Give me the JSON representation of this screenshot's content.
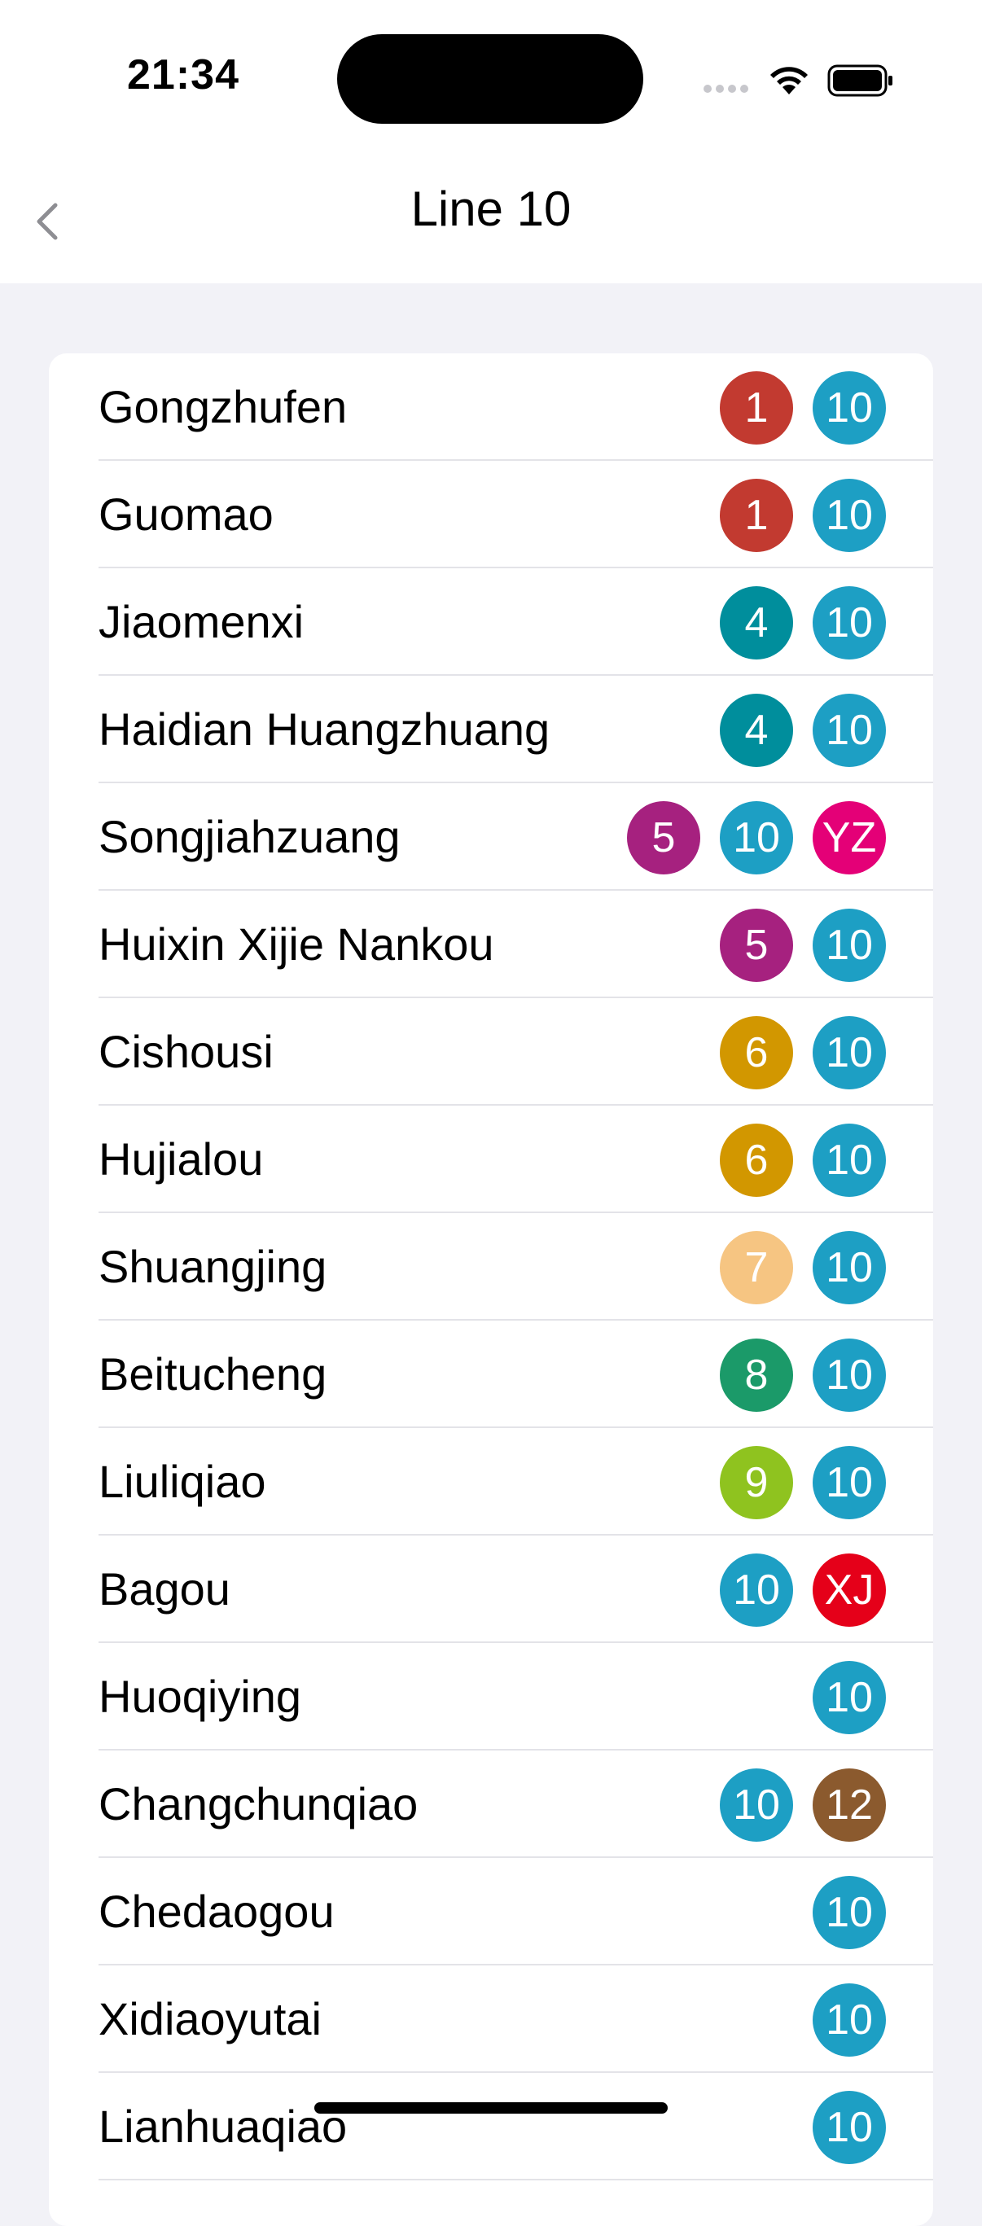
{
  "status": {
    "time": "21:34"
  },
  "nav": {
    "title": "Line 10",
    "back_icon": "chevron-left-icon"
  },
  "line_colors": {
    "1": "#c23a30",
    "4": "#008e9c",
    "5": "#a6217f",
    "6": "#d29700",
    "7": "#f6c582",
    "8": "#1b9a69",
    "9": "#8fc31f",
    "10": "#1d9fc4",
    "12": "#8b5a2e",
    "YZ": "#e40077",
    "XJ": "#e50019"
  },
  "stations": [
    {
      "name": "Gongzhufen",
      "lines": [
        "1",
        "10"
      ]
    },
    {
      "name": "Guomao",
      "lines": [
        "1",
        "10"
      ]
    },
    {
      "name": "Jiaomenxi",
      "lines": [
        "4",
        "10"
      ]
    },
    {
      "name": "Haidian Huangzhuang",
      "lines": [
        "4",
        "10"
      ]
    },
    {
      "name": "Songjiahzuang",
      "lines": [
        "5",
        "10",
        "YZ"
      ]
    },
    {
      "name": "Huixin Xijie Nankou",
      "lines": [
        "5",
        "10"
      ]
    },
    {
      "name": "Cishousi",
      "lines": [
        "6",
        "10"
      ]
    },
    {
      "name": "Hujialou",
      "lines": [
        "6",
        "10"
      ]
    },
    {
      "name": "Shuangjing",
      "lines": [
        "7",
        "10"
      ]
    },
    {
      "name": "Beitucheng",
      "lines": [
        "8",
        "10"
      ]
    },
    {
      "name": "Liuliqiao",
      "lines": [
        "9",
        "10"
      ]
    },
    {
      "name": "Bagou",
      "lines": [
        "10",
        "XJ"
      ]
    },
    {
      "name": "Huoqiying",
      "lines": [
        "10"
      ]
    },
    {
      "name": "Changchunqiao",
      "lines": [
        "10",
        "12"
      ]
    },
    {
      "name": "Chedaogou",
      "lines": [
        "10"
      ]
    },
    {
      "name": "Xidiaoyutai",
      "lines": [
        "10"
      ]
    },
    {
      "name": "Lianhuaqiao",
      "lines": [
        "10"
      ]
    }
  ]
}
